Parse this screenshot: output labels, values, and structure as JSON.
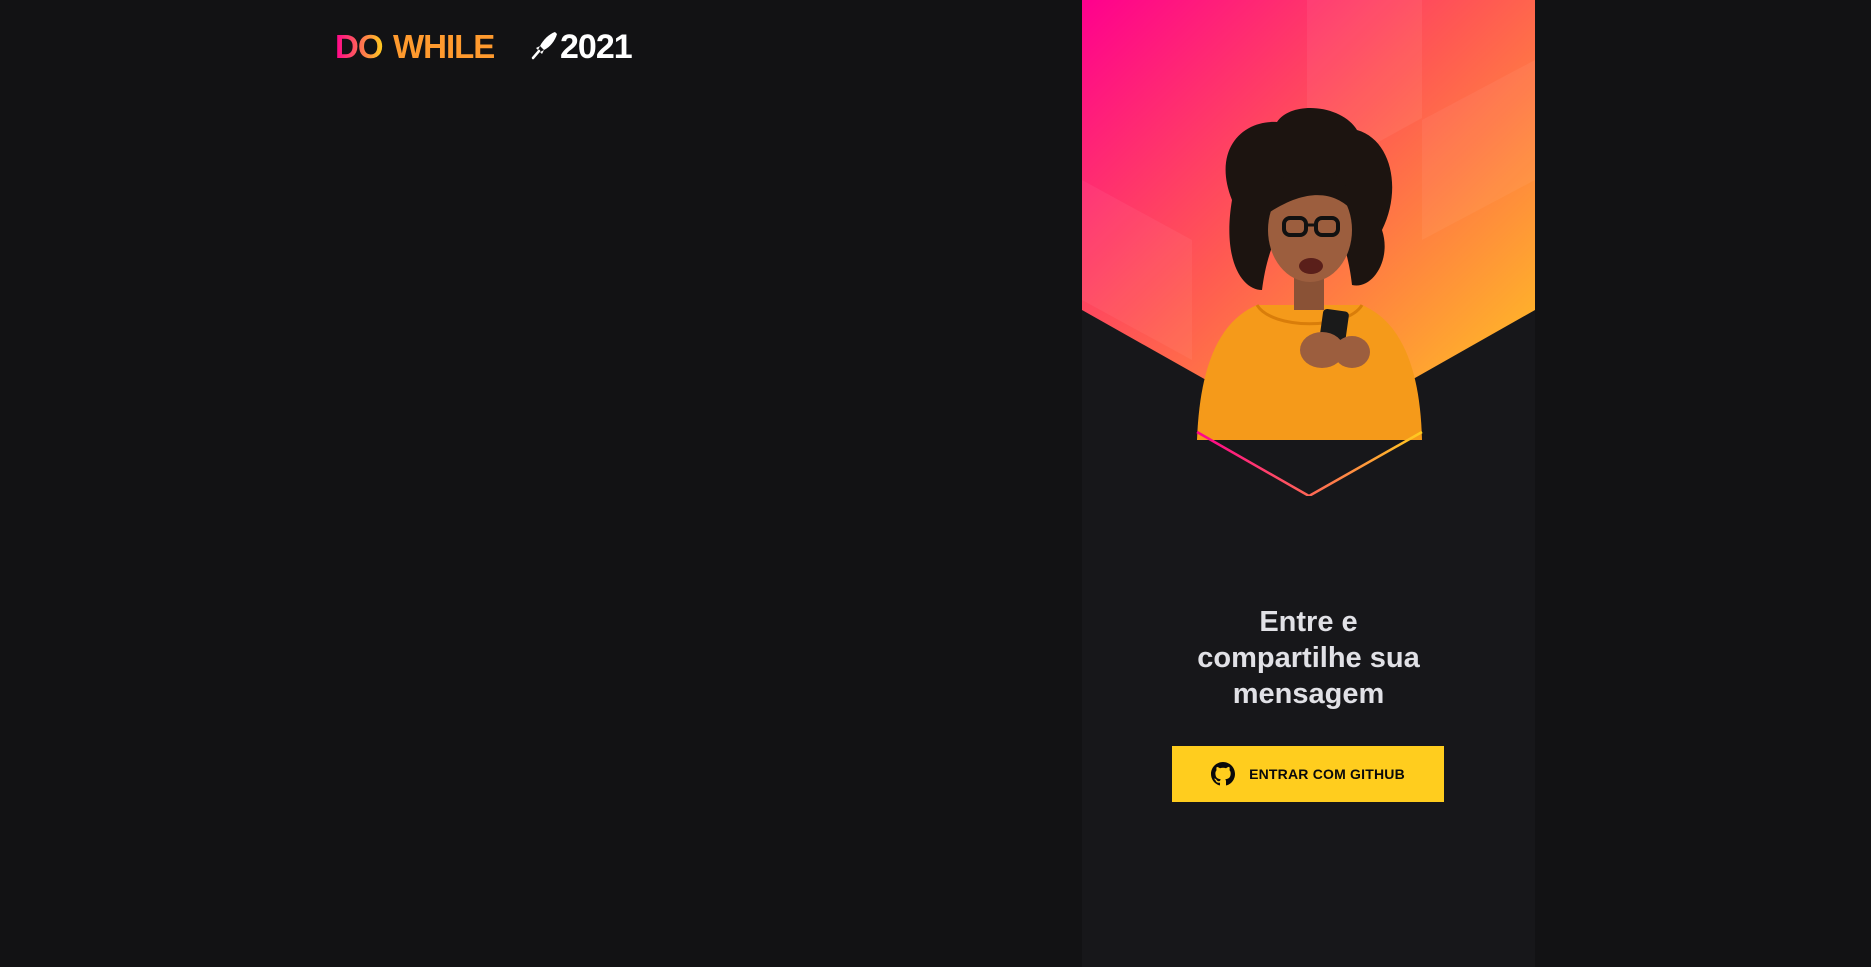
{
  "logo": {
    "word_do": "DO",
    "word_while": "WHILE",
    "year": "2021",
    "text": "DOWHILE 2021",
    "icon": "rocket-icon"
  },
  "login": {
    "title": "Entre e compartilhe sua mensagem",
    "button_label": "ENTRAR COM GITHUB",
    "button_icon": "github-icon"
  },
  "colors": {
    "background": "#121214",
    "panel_background": "#17171a",
    "button_background": "#ffcd1e",
    "button_text": "#09090a",
    "title_text": "#e1e1e6",
    "gradient_start": "#ff008e",
    "gradient_end": "#ffcd1e"
  }
}
